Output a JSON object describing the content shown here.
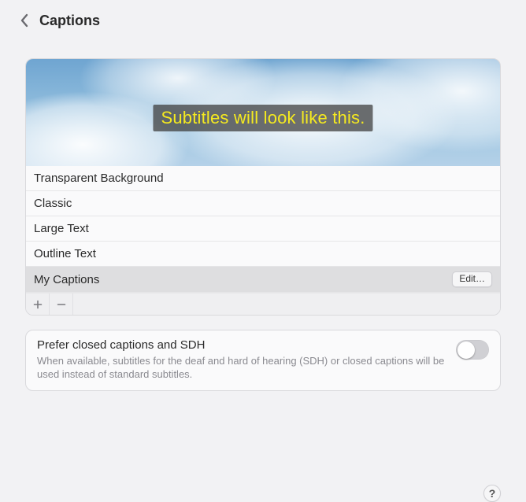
{
  "header": {
    "title": "Captions"
  },
  "preview": {
    "subtitle_text": "Subtitles will look like this.",
    "subtitle_color": "#f5ea1f",
    "subtitle_bg": "rgba(64,64,64,0.75)"
  },
  "styles": [
    {
      "label": "Transparent Background",
      "selected": false,
      "editable": false
    },
    {
      "label": "Classic",
      "selected": false,
      "editable": false
    },
    {
      "label": "Large Text",
      "selected": false,
      "editable": false
    },
    {
      "label": "Outline Text",
      "selected": false,
      "editable": false
    },
    {
      "label": "My Captions",
      "selected": true,
      "editable": true
    }
  ],
  "edit_label": "Edit…",
  "sdh": {
    "title": "Prefer closed captions and SDH",
    "description": "When available, subtitles for the deaf and hard of hearing (SDH) or closed captions will be used instead of standard subtitles.",
    "enabled": false
  },
  "help_label": "?"
}
